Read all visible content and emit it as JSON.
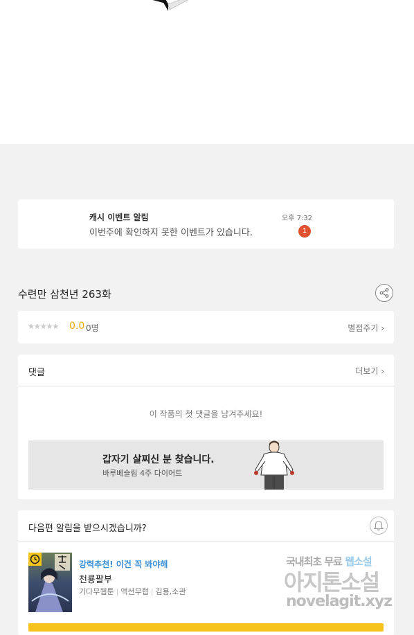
{
  "notification": {
    "title": "캐시 이벤트 알림",
    "message": "이번주에 확인하지 못한 이벤트가 있습니다.",
    "time": "오후 7:32",
    "badge": "1"
  },
  "episode": {
    "title": "수련만 삼천년 263화",
    "share_icon": "share-icon"
  },
  "rating": {
    "stars": "★★★★★",
    "score": "0.0",
    "count": "0명",
    "rate_link": "별점주기 ›"
  },
  "comments": {
    "title": "댓글",
    "more": "더보기 ›",
    "empty": "이 작품의 첫 댓글을 남겨주세요!",
    "banner": {
      "title": "갑자기 살찌신 분 찾습니다.",
      "subtitle": "바루베슬림 4주 다이어트"
    }
  },
  "next": {
    "title": "다음편 알림을 받으시겠습니까?",
    "bell_icon": "bell-icon",
    "recommend": {
      "label": "강력추천! 이건 꼭 봐야해",
      "title": "천룡팔부",
      "meta": [
        "기다무웹툰",
        "액션무협",
        "김용,소관"
      ]
    }
  },
  "watermark": {
    "line1": "국내최초 무료 ",
    "line1_highlight": "웹소설",
    "line2": "아지톤소설",
    "line3": "novelagit.xyz"
  },
  "colors": {
    "accent_star": "#f2a900",
    "badge": "#e0522f",
    "recommend_label": "#3a8fd6",
    "cta_bar": "#f6c21c"
  }
}
